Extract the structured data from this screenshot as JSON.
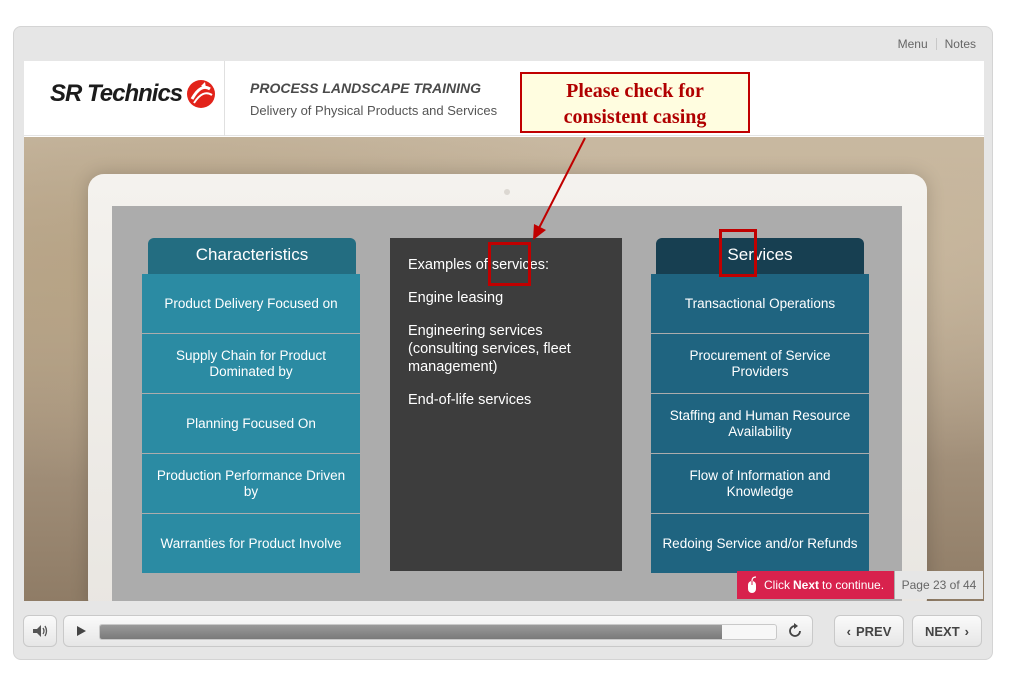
{
  "player": {
    "nav": {
      "menu_label": "Menu",
      "notes_label": "Notes"
    },
    "continue_prompt": {
      "prefix": "Click",
      "bold": "Next",
      "suffix": "to continue."
    },
    "page_indicator": "Page 23 of 44",
    "progress": 0.92,
    "prev_label": "PREV",
    "next_label": "NEXT",
    "icons": {
      "volume": "speaker-icon",
      "play": "play-icon",
      "replay": "replay-icon",
      "prev": "chevron-left-icon",
      "next": "chevron-right-icon",
      "mouse": "mouse-icon"
    }
  },
  "header": {
    "logo_text": "SR Technics",
    "title": "PROCESS LANDSCAPE TRAINING",
    "subtitle": "Delivery of Physical Products and Services"
  },
  "characteristics": {
    "header": "Characteristics",
    "items": [
      "Product Delivery Focused on",
      "Supply Chain for Product Dominated by",
      "Planning Focused On",
      "Production Performance Driven by",
      "Warranties for Product Involve"
    ]
  },
  "examples": {
    "heading": "Examples of services:",
    "items": [
      "Engine leasing",
      "Engineering services (consulting services, fleet management)",
      "End-of-life services"
    ]
  },
  "services": {
    "header": "Services",
    "items": [
      "Transactional Operations",
      "Procurement of Service Providers",
      "Staffing and Human Resource Availability",
      "Flow of Information and Knowledge",
      "Redoing Service and/or Refunds"
    ]
  },
  "annotation": {
    "line1": "Please check for",
    "line2": "consistent casing",
    "color": "#c00000"
  },
  "colors": {
    "char_header": "#236d81",
    "char_cell": "#2b8ba3",
    "serv_header": "#173f51",
    "serv_cell": "#1f6480",
    "continue_bg": "#d8224d"
  }
}
